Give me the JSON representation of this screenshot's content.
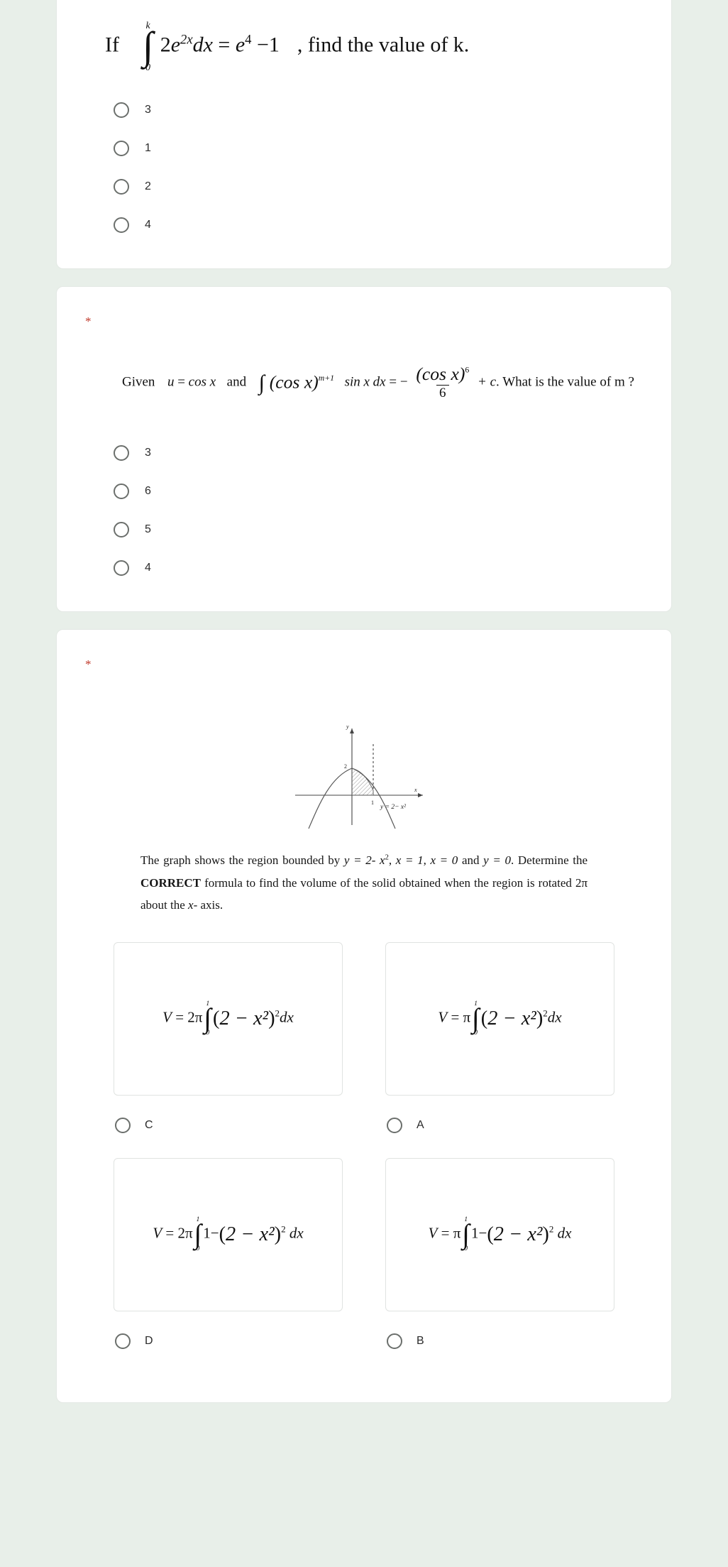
{
  "theme": {
    "page_background": "#e8efe9",
    "card_background": "#ffffff",
    "required_star_color": "#c0392b",
    "radio_border_color": "#6b6f6c",
    "text_color": "#101010"
  },
  "questions": [
    {
      "id": "q1",
      "required_marker": "",
      "stem": {
        "lead": "If",
        "integral_upper": "k",
        "integral_lower": "0",
        "integrand_coefficient": "2",
        "integrand_base": "e",
        "integrand_exponent": "2x",
        "differential": "dx",
        "equals": "=",
        "rhs_base": "e",
        "rhs_exponent": "4",
        "rhs_minus": "−",
        "rhs_term": "1",
        "tail": ", find the value of k."
      },
      "options": [
        {
          "label": "3",
          "selected": false
        },
        {
          "label": "1",
          "selected": false
        },
        {
          "label": "2",
          "selected": false
        },
        {
          "label": "4",
          "selected": false
        }
      ]
    },
    {
      "id": "q2",
      "required_marker": "*",
      "stem": {
        "lead": "Given",
        "u_var": "u",
        "u_equals": "=",
        "u_value": "cos x",
        "and": "and",
        "integrand_base": "(cos x)",
        "integrand_exponent": "m+1",
        "integrand_factor": "sin x dx",
        "equals": "=",
        "minus": "−",
        "fraction_numerator_base": "(cos x)",
        "fraction_numerator_exponent": "6",
        "fraction_denominator": "6",
        "plus_c": "+ c",
        "tail": ". What is the value of m ?"
      },
      "options": [
        {
          "label": "3",
          "selected": false
        },
        {
          "label": "6",
          "selected": false
        },
        {
          "label": "5",
          "selected": false
        },
        {
          "label": "4",
          "selected": false
        }
      ]
    },
    {
      "id": "q3",
      "required_marker": "*",
      "graph": {
        "curve_label": "y = 2 − x²",
        "y_axis_label": "y",
        "x_axis_label": "x",
        "y_tick": "2",
        "x_tick": "1",
        "shaded_region": "between x = 0 and x = 1 under the parabola"
      },
      "prompt_parts": {
        "line1_a": "The graph shows the region bounded by",
        "fn": "y = 2- x",
        "fn_exp": "2",
        "bound1": "x = 1",
        "bound2": "x = 0",
        "and": "and",
        "bound3": "y = 0",
        "period": ".",
        "line2_a": "Determine the",
        "emphasis": "CORRECT",
        "line2_b": "formula to find the volume of the solid obtained when the",
        "line3_a": "region is rotated",
        "rotation": "2π",
        "line3_b": "about the",
        "axis": "x",
        "line3_c": "- axis."
      },
      "choices": [
        {
          "letter": "C",
          "formula": {
            "V": "V",
            "equals": "=",
            "coefficient": "2π",
            "upper": "1",
            "lower": "0",
            "inner": "2 − x²",
            "power": "2",
            "dx": "dx",
            "form": "simple"
          }
        },
        {
          "letter": "A",
          "formula": {
            "V": "V",
            "equals": "=",
            "coefficient": "π",
            "upper": "1",
            "lower": "0",
            "inner": "2 − x²",
            "power": "2",
            "dx": "dx",
            "form": "simple"
          }
        },
        {
          "letter": "D",
          "formula": {
            "V": "V",
            "equals": "=",
            "coefficient": "2π",
            "upper": "1",
            "lower": "0",
            "prefix": "1−",
            "inner": "2 − x²",
            "power": "2",
            "dx": "dx",
            "form": "with-one-minus"
          }
        },
        {
          "letter": "B",
          "formula": {
            "V": "V",
            "equals": "=",
            "coefficient": "π",
            "upper": "1",
            "lower": "0",
            "prefix": "1−",
            "inner": "2 − x²",
            "power": "2",
            "dx": "dx",
            "form": "with-one-minus"
          }
        }
      ]
    }
  ]
}
